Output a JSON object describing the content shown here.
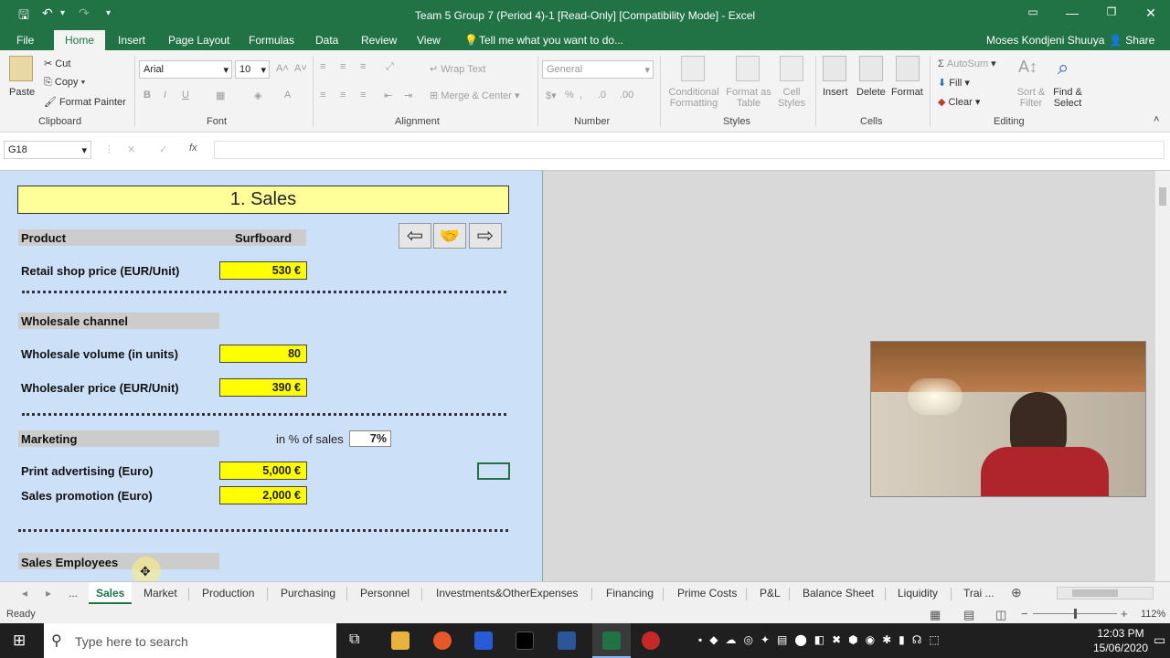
{
  "window": {
    "title": "Team 5 Group 7 (Period 4)-1  [Read-Only]  [Compatibility Mode] - Excel",
    "user": "Moses Kondjeni Shuuya",
    "share": "Share"
  },
  "ribbon_tabs": [
    "File",
    "Home",
    "Insert",
    "Page Layout",
    "Formulas",
    "Data",
    "Review",
    "View"
  ],
  "tell_me": "Tell me what you want to do...",
  "clipboard": {
    "paste": "Paste",
    "cut": "Cut",
    "copy": "Copy",
    "format_painter": "Format Painter",
    "group": "Clipboard"
  },
  "font": {
    "name": "Arial",
    "size": "10",
    "group": "Font"
  },
  "alignment": {
    "wrap": "Wrap Text",
    "merge": "Merge & Center",
    "group": "Alignment"
  },
  "number": {
    "format": "General",
    "group": "Number"
  },
  "styles": {
    "conditional": "Conditional",
    "conditional2": "Formatting",
    "format_as": "Format as",
    "format_as2": "Table",
    "cell": "Cell",
    "cell2": "Styles",
    "group": "Styles"
  },
  "cells": {
    "insert": "Insert",
    "delete": "Delete",
    "format": "Format",
    "group": "Cells"
  },
  "editing": {
    "autosum": "AutoSum",
    "fill": "Fill",
    "clear": "Clear",
    "sort": "Sort &",
    "sort2": "Filter",
    "find": "Find &",
    "find2": "Select",
    "group": "Editing"
  },
  "namebox": "G18",
  "fx": "fx",
  "sheet": {
    "title": "1. Sales",
    "product_label": "Product",
    "product_value": "Surfboard",
    "retail_label": "Retail shop price (EUR/Unit)",
    "retail_value": "530 €",
    "wholesale_header": "Wholesale channel",
    "wholesale_volume_label": "Wholesale volume (in units)",
    "wholesale_volume_value": "80",
    "wholesaler_price_label": "Wholesaler price (EUR/Unit)",
    "wholesaler_price_value": "390 €",
    "marketing_header": "Marketing",
    "pct_label": "in % of sales",
    "pct_value": "7%",
    "print_label": "Print advertising (Euro)",
    "print_value": "5,000 €",
    "promo_label": "Sales promotion (Euro)",
    "promo_value": "2,000 €",
    "employees_header": "Sales Employees"
  },
  "sheet_tabs": [
    "...",
    "Sales",
    "Market",
    "Production",
    "Purchasing",
    "Personnel",
    "Investments&OtherExpenses",
    "Financing",
    "Prime Costs",
    "P&L",
    "Balance Sheet",
    "Liquidity",
    "Trai ..."
  ],
  "status": {
    "ready": "Ready",
    "zoom": "112%"
  },
  "taskbar": {
    "search": "Type here to search",
    "time": "12:03 PM",
    "date": "15/06/2020"
  }
}
